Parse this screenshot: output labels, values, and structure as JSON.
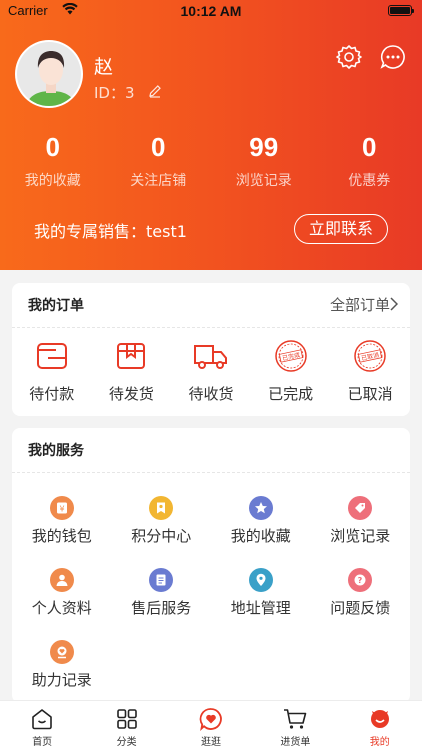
{
  "status_bar": {
    "carrier": "Carrier",
    "time": "10:12 AM"
  },
  "profile": {
    "name": "赵",
    "id_text": "ID：3"
  },
  "stats": [
    {
      "value": "0",
      "label": "我的收藏"
    },
    {
      "value": "0",
      "label": "关注店铺"
    },
    {
      "value": "99",
      "label": "浏览记录"
    },
    {
      "value": "0",
      "label": "优惠券"
    }
  ],
  "sales": {
    "text": "我的专属销售：test1",
    "contact_button": "立即联系"
  },
  "orders": {
    "title": "我的订单",
    "all_link": "全部订单",
    "items": [
      {
        "label": "待付款",
        "icon": "wallet-icon"
      },
      {
        "label": "待发货",
        "icon": "package-icon"
      },
      {
        "label": "待收货",
        "icon": "truck-icon"
      },
      {
        "label": "已完成",
        "icon": "completed-stamp-icon",
        "stamp_text": "已完成"
      },
      {
        "label": "已取消",
        "icon": "cancelled-stamp-icon",
        "stamp_text": "已取消"
      }
    ]
  },
  "services": {
    "title": "我的服务",
    "items": [
      {
        "label": "我的钱包",
        "icon": "wallet-yen-icon",
        "color": "#f08a4b"
      },
      {
        "label": "积分中心",
        "icon": "points-bookmark-icon",
        "color": "#f2b632"
      },
      {
        "label": "我的收藏",
        "icon": "star-icon",
        "color": "#6a7bd1"
      },
      {
        "label": "浏览记录",
        "icon": "tag-icon",
        "color": "#ee6f7a"
      },
      {
        "label": "个人资料",
        "icon": "person-icon",
        "color": "#f08a4b"
      },
      {
        "label": "售后服务",
        "icon": "document-icon",
        "color": "#6a7bd1"
      },
      {
        "label": "地址管理",
        "icon": "location-icon",
        "color": "#3aa0c8"
      },
      {
        "label": "问题反馈",
        "icon": "question-icon",
        "color": "#ee6f7a"
      },
      {
        "label": "助力记录",
        "icon": "heart-hand-icon",
        "color": "#f08a4b"
      }
    ]
  },
  "tabbar": [
    {
      "label": "首页",
      "icon": "home-icon",
      "active": false
    },
    {
      "label": "分类",
      "icon": "grid-icon",
      "active": false
    },
    {
      "label": "逛逛",
      "icon": "heart-chat-icon",
      "active": false
    },
    {
      "label": "进货单",
      "icon": "cart-icon",
      "active": false
    },
    {
      "label": "我的",
      "icon": "profile-icon",
      "active": true
    }
  ],
  "colors": {
    "brand_red": "#e83a26",
    "brand_orange": "#f86a1b"
  }
}
